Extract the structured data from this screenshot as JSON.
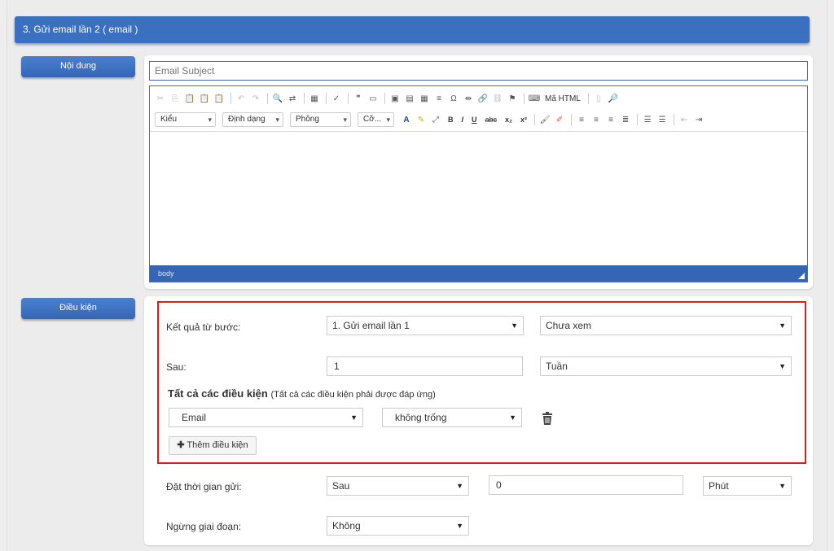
{
  "step_header": "3. Gửi email lần 2 ( email )",
  "content_label": "Nội dung",
  "subject_placeholder": "Email Subject",
  "editor": {
    "toolbar_html_label": "Mã HTML",
    "combos": [
      "Kiểu",
      "Định dạng",
      "Phông",
      "Cỡ..."
    ],
    "format_buttons": [
      "B",
      "I",
      "U",
      "abc",
      "x₂",
      "x²"
    ],
    "status_text": "body"
  },
  "conditions_label": "Điều kiện",
  "conditions": {
    "result_label": "Kết quả từ bước:",
    "result_step": "1. Gửi email lần 1",
    "result_status": "Chưa xem",
    "after_label": "Sau:",
    "after_value": "1",
    "after_unit": "Tuần",
    "all_title": "Tất cả các điều kiện",
    "all_subtitle": "(Tất cả các điều kiện phải được đáp ứng)",
    "rule_field": "Email",
    "rule_operator": "không trống",
    "add_button": "Thêm điều kiện"
  },
  "schedule": {
    "send_time_label": "Đặt thời gian gửi:",
    "send_when": "Sau",
    "send_amount": "0",
    "send_unit": "Phút",
    "stop_label": "Ngừng giai đoạn:",
    "stop_value": "Không"
  },
  "colors": {
    "primary": "#3b6fc0",
    "highlight_border": "#e01b1b"
  }
}
